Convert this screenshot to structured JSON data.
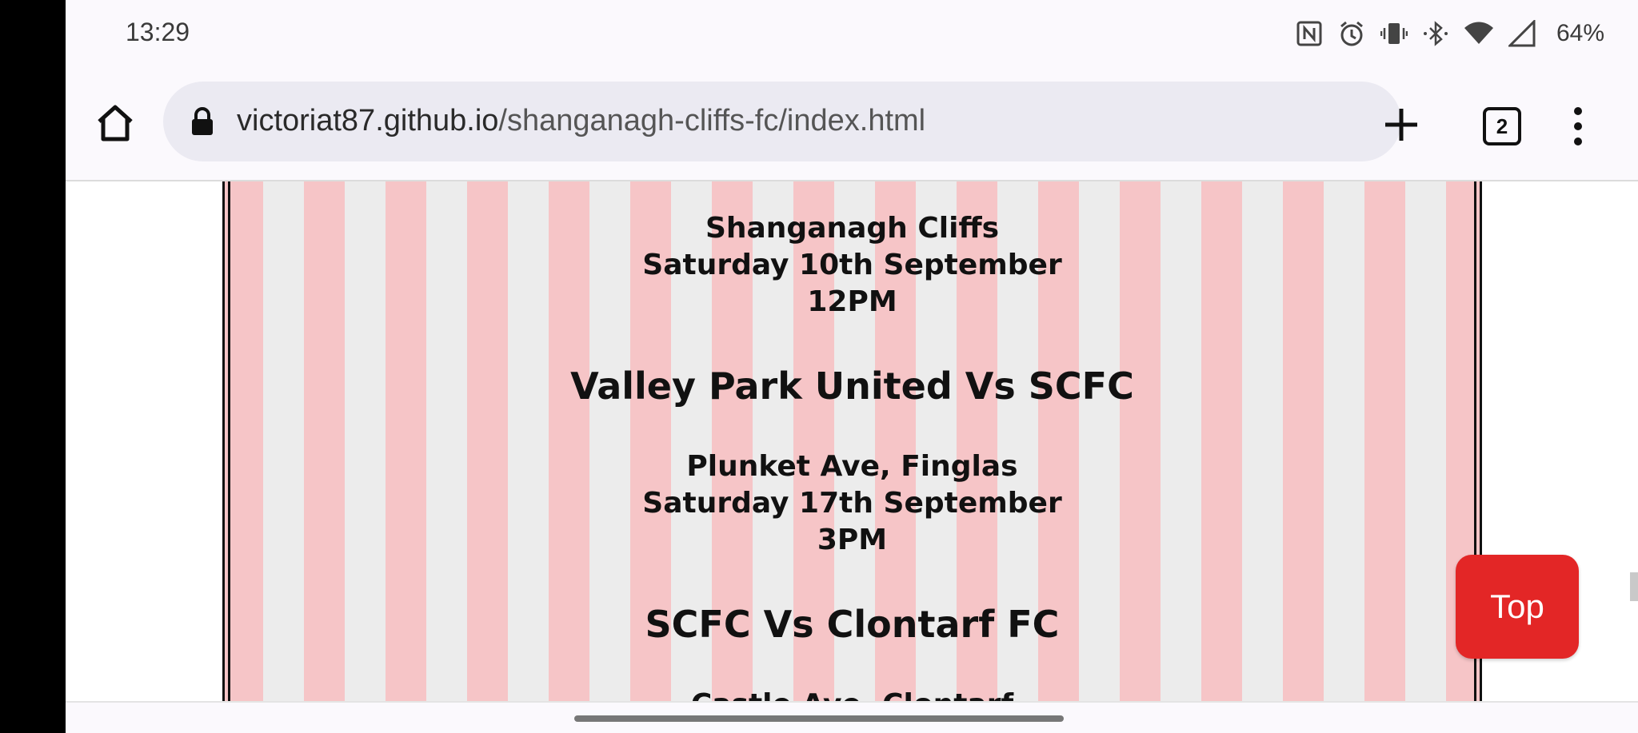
{
  "status_bar": {
    "time": "13:29",
    "battery": "64%",
    "icons": [
      "nfc-icon",
      "alarm-icon",
      "vibrate-icon",
      "bluetooth-icon",
      "wifi-icon",
      "signal-icon"
    ]
  },
  "browser": {
    "url_domain": "victoriat87.github.io",
    "url_path": "/shanganagh-cliffs-fc/index.html",
    "tab_count": "2"
  },
  "fixtures": [
    {
      "venue": "Shanganagh Cliffs",
      "date": "Saturday 10th September",
      "time": "12PM"
    },
    {
      "match": "Valley Park United Vs SCFC",
      "venue": "Plunket Ave, Finglas",
      "date": "Saturday 17th September",
      "time": "3PM"
    },
    {
      "match": "SCFC Vs Clontarf FC",
      "venue": "Castle Ave, Clontarf"
    }
  ],
  "top_button": "Top",
  "colors": {
    "stripe_pink": "#f6c5c7",
    "stripe_grey": "#ececec",
    "top_button_red": "#e32626"
  }
}
